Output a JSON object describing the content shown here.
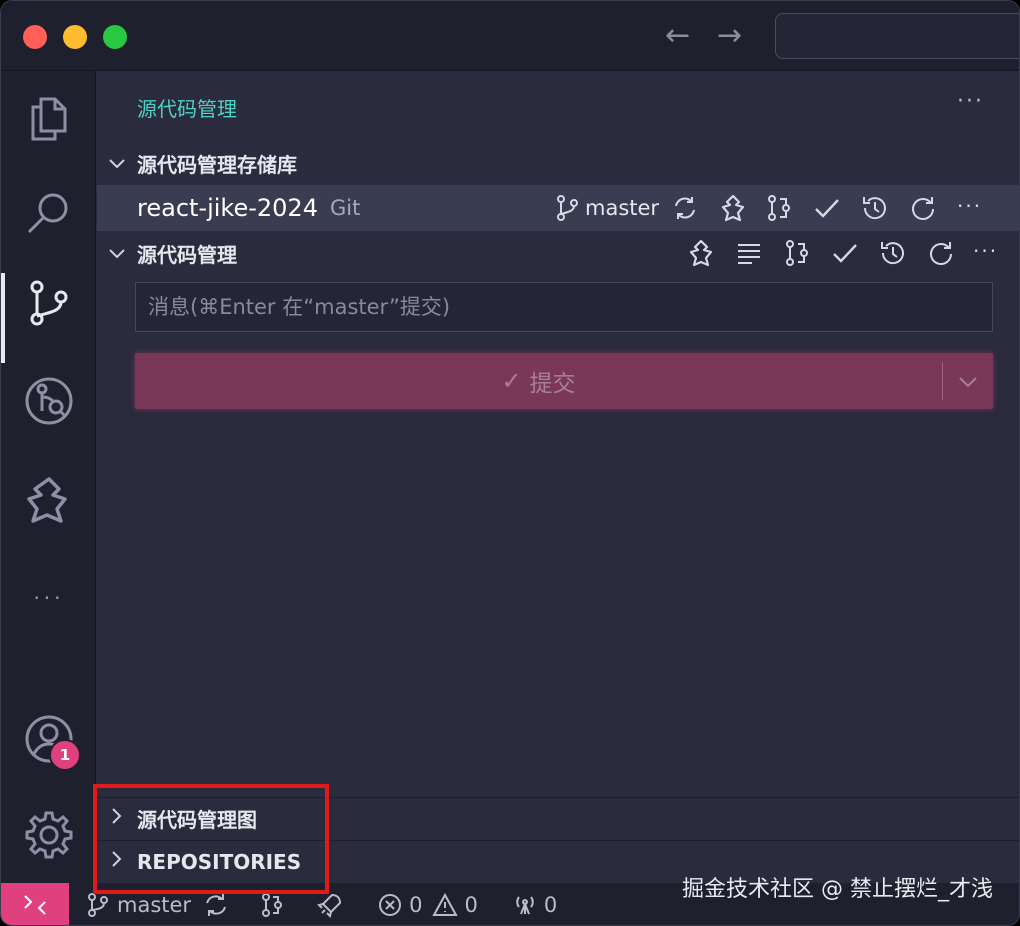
{
  "titlebar": {
    "nav_back": "←",
    "nav_forward": "→"
  },
  "activity": {
    "badge_count": "1",
    "more": "···"
  },
  "panel": {
    "title": "源代码管理",
    "more": "···"
  },
  "repositories_section": {
    "label": "源代码管理存储库"
  },
  "repo": {
    "name": "react-jike-2024",
    "type": "Git",
    "branch": "master"
  },
  "changes_section": {
    "label": "源代码管理"
  },
  "commit": {
    "placeholder": "消息(⌘Enter 在“master”提交)",
    "button_label": "提交",
    "check": "✓",
    "dropdown": "⌄"
  },
  "bottom_sections": {
    "graph_label": "源代码管理图",
    "repositories_label": "REPOSITORIES"
  },
  "statusbar": {
    "branch": "master",
    "errors": "0",
    "warnings": "0",
    "ports": "0"
  },
  "watermark": "掘金技术社区 @ 禁止摆烂_才浅",
  "colors": {
    "accent": "#e0417e",
    "title_teal": "#4fd1c5",
    "commit_button": "#7a3859",
    "annotation_box": "#e11919"
  }
}
